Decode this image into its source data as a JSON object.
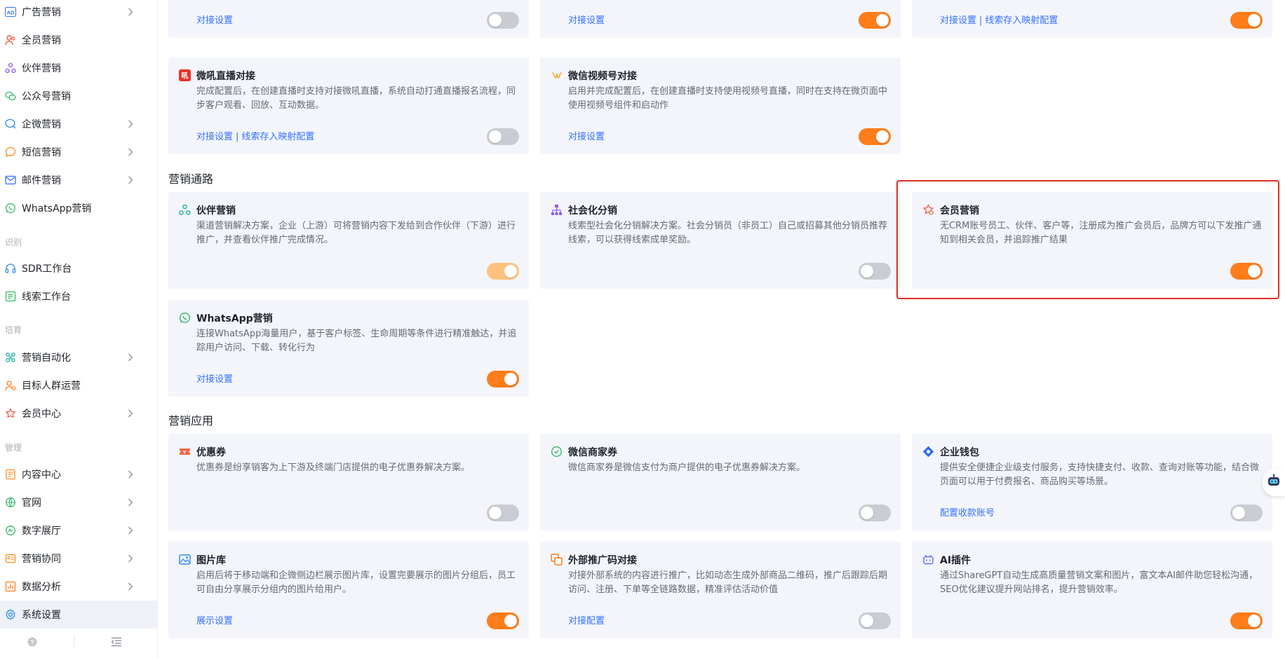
{
  "sidebar": {
    "items": [
      {
        "label": "广告营销",
        "icon": "ad-icon",
        "chevron": true,
        "color": "#3370ff"
      },
      {
        "label": "全员营销",
        "icon": "people-icon",
        "chevron": false,
        "color": "#f05a4a"
      },
      {
        "label": "伙伴营销",
        "icon": "partner-icon",
        "chevron": false,
        "color": "#8c5cf0"
      },
      {
        "label": "公众号营销",
        "icon": "wechat-official-icon",
        "chevron": false,
        "color": "#35b86a"
      },
      {
        "label": "企微营销",
        "icon": "wecom-icon",
        "chevron": true,
        "color": "#2b8cf0"
      },
      {
        "label": "短信营销",
        "icon": "sms-icon",
        "chevron": true,
        "color": "#ff8a1a"
      },
      {
        "label": "邮件营销",
        "icon": "mail-icon",
        "chevron": true,
        "color": "#3370ff"
      },
      {
        "label": "WhatsApp营销",
        "icon": "whatsapp-icon",
        "chevron": false,
        "color": "#35b86a"
      }
    ],
    "group_identify": "识别",
    "items_identify": [
      {
        "label": "SDR工作台",
        "icon": "headset-icon",
        "chevron": false,
        "color": "#2b8cf0"
      },
      {
        "label": "线索工作台",
        "icon": "leads-icon",
        "chevron": false,
        "color": "#35b86a"
      }
    ],
    "group_nurture": "培育",
    "items_nurture": [
      {
        "label": "营销自动化",
        "icon": "automation-icon",
        "chevron": true,
        "color": "#1fb5a6"
      },
      {
        "label": "目标人群运营",
        "icon": "target-people-icon",
        "chevron": false,
        "color": "#ff7d1a"
      },
      {
        "label": "会员中心",
        "icon": "member-icon",
        "chevron": true,
        "color": "#f05a4a"
      }
    ],
    "group_manage": "管理",
    "items_manage": [
      {
        "label": "内容中心",
        "icon": "content-icon",
        "chevron": true,
        "color": "#ff8a1a"
      },
      {
        "label": "官网",
        "icon": "website-icon",
        "chevron": true,
        "color": "#35b86a"
      },
      {
        "label": "数字展厅",
        "icon": "digital-hall-icon",
        "chevron": true,
        "color": "#35b86a"
      },
      {
        "label": "营销协同",
        "icon": "collaboration-icon",
        "chevron": true,
        "color": "#ff8a1a"
      },
      {
        "label": "数据分析",
        "icon": "analytics-icon",
        "chevron": true,
        "color": "#ff7d1a"
      },
      {
        "label": "系统设置",
        "icon": "gear-icon",
        "chevron": false,
        "color": "#2b8cf0",
        "active": true
      }
    ]
  },
  "top_row": [
    {
      "link": "对接设置",
      "toggle": "off"
    },
    {
      "link": "对接设置",
      "toggle": "on"
    },
    {
      "link": "对接设置",
      "link2": "线索存入映射配置",
      "toggle": "on"
    }
  ],
  "live_row": [
    {
      "title": "微吼直播对接",
      "icon": "vhall-icon",
      "desc": "完成配置后，在创建直播时支持对接微吼直播，系统自动打通直播报名流程，同步客户观看、回放、互动数据。",
      "link": "对接设置",
      "link2": "线索存入映射配置",
      "toggle": "off"
    },
    {
      "title": "微信视频号对接",
      "icon": "channels-icon",
      "desc": "启用并完成配置后，在创建直播时支持使用视频号直播，同时在支持在微页面中使用视频号组件和启动作",
      "link": "对接设置",
      "toggle": "on"
    }
  ],
  "section_channels": "营销通路",
  "channels": [
    {
      "title": "伙伴营销",
      "icon": "partner-icon",
      "desc": "渠道营销解决方案，企业（上游）可将营销内容下发给到合作伙伴（下游）进行推广，并查看伙伴推广完成情况。",
      "toggle": "disabled"
    },
    {
      "title": "社会化分销",
      "icon": "distribution-icon",
      "desc": "线索型社会化分销解决方案。社会分销员（非员工）自己或招募其他分销员推荐线索，可以获得线索成单奖励。",
      "toggle": "off"
    },
    {
      "title": "会员营销",
      "icon": "member-marketing-icon",
      "desc": "无CRM账号员工、伙伴、客户等，注册成为推广会员后，品牌方可以下发推广通知到相关会员，并追踪推广结果",
      "toggle": "on"
    },
    {
      "title": "WhatsApp营销",
      "icon": "whatsapp-icon",
      "desc": "连接WhatsApp海量用户，基于客户标签、生命周期等条件进行精准触达，并追踪用户访问、下载、转化行为",
      "link": "对接设置",
      "toggle": "on"
    }
  ],
  "section_apps": "营销应用",
  "apps": [
    {
      "title": "优惠券",
      "icon": "coupon-icon",
      "desc": "优惠券是纷享销客为上下游及终端门店提供的电子优惠券解决方案。",
      "toggle": "off"
    },
    {
      "title": "微信商家券",
      "icon": "wechat-coupon-icon",
      "desc": "微信商家券是微信支付为商户提供的电子优惠券解决方案。",
      "toggle": "off"
    },
    {
      "title": "企业钱包",
      "icon": "wallet-icon",
      "desc": "提供安全便捷企业级支付服务，支持快捷支付、收款、查询对账等功能，结合微页面可以用于付费报名、商品购买等场景。",
      "link": "配置收款账号",
      "toggle": "off"
    },
    {
      "title": "图片库",
      "icon": "image-library-icon",
      "desc": "启用后将于移动端和企微侧边栏展示图片库，设置完要展示的图片分组后，员工可自由分享展示分组内的图片给用户。",
      "link": "展示设置",
      "toggle": "on"
    },
    {
      "title": "外部推广码对接",
      "icon": "promo-code-icon",
      "desc": "对接外部系统的内容进行推广，比如动态生成外部商品二维码，推广后跟踪后期访问、注册、下单等全链路数据，精准评估活动价值",
      "link": "对接配置",
      "toggle": "off"
    },
    {
      "title": "AI插件",
      "icon": "ai-bot-icon",
      "desc": "通过ShareGPT自动生成高质量营销文案和图片，富文本AI邮件助您轻松沟通，SEO优化建议提升网站排名，提升营销效率。",
      "toggle": "on"
    }
  ],
  "colors": {
    "accent": "#ff7d1a",
    "link": "#3370ff",
    "highlight": "#e32b23",
    "card_bg": "#f3f5fb"
  }
}
